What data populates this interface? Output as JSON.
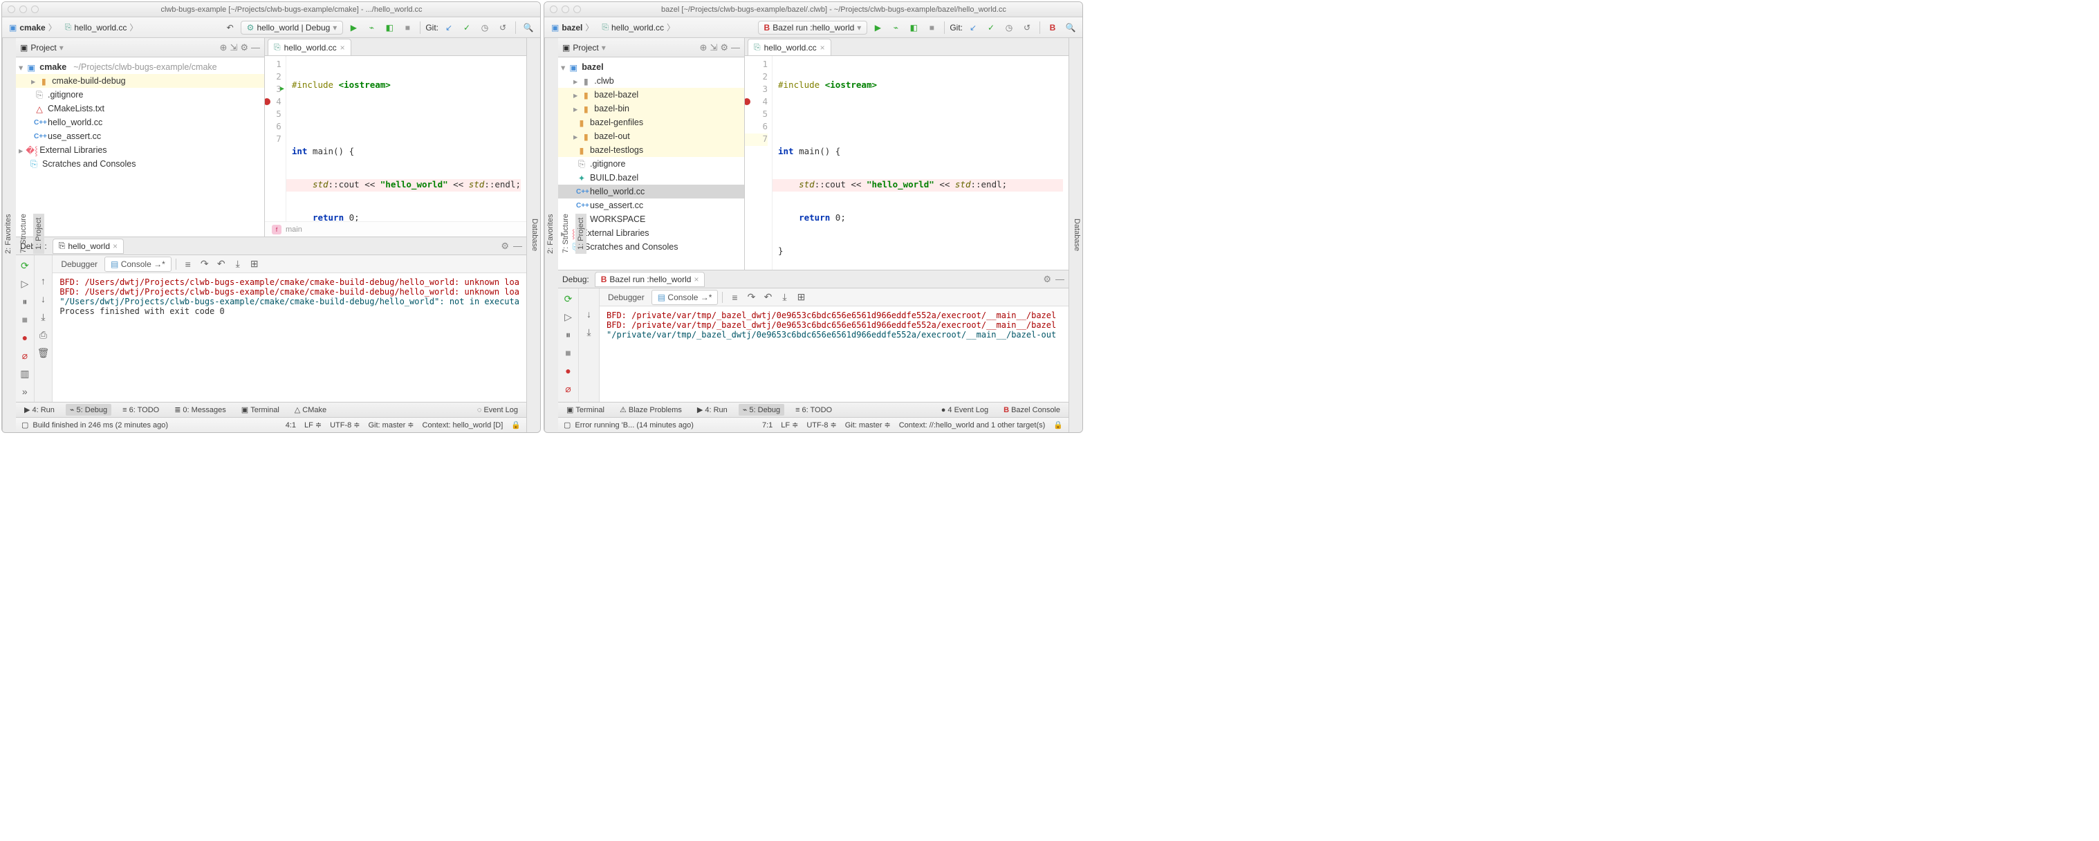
{
  "left": {
    "title": "clwb-bugs-example [~/Projects/clwb-bugs-example/cmake] - .../hello_world.cc",
    "breadcrumb": {
      "root": "cmake",
      "file": "hello_world.cc"
    },
    "run_config": "hello_world | Debug",
    "git_label": "Git:",
    "rail": {
      "project": "1: Project",
      "structure": "7: Structure",
      "favorites": "2: Favorites",
      "database": "Database"
    },
    "project": {
      "header": "Project",
      "root": "cmake",
      "root_path": "~/Projects/clwb-bugs-example/cmake",
      "items": [
        {
          "label": "cmake-build-debug",
          "kind": "folder",
          "indent": 1,
          "highlight": true,
          "expandable": true
        },
        {
          "label": ".gitignore",
          "kind": "file",
          "indent": 1
        },
        {
          "label": "CMakeLists.txt",
          "kind": "cmake",
          "indent": 1
        },
        {
          "label": "hello_world.cc",
          "kind": "cc",
          "indent": 1
        },
        {
          "label": "use_assert.cc",
          "kind": "cc",
          "indent": 1
        }
      ],
      "ext_libs": "External Libraries",
      "scratches": "Scratches and Consoles"
    },
    "editor": {
      "tab": "hello_world.cc",
      "lines": [
        "1",
        "2",
        "3",
        "4",
        "5",
        "6",
        "7"
      ],
      "code": {
        "l1_pre": "#include",
        "l1_inc": "<iostream>",
        "l3_kw1": "int",
        "l3_rest": " main() {",
        "l4_ns1": "std",
        "l4_op1": "::cout << ",
        "l4_str": "\"hello_world\"",
        "l4_op2": " << ",
        "l4_ns2": "std",
        "l4_op3": "::endl;",
        "l5_kw": "return",
        "l5_rest": " 0;",
        "l6": "}"
      },
      "footer_symbol": "main"
    },
    "debug": {
      "label": "Debug:",
      "run_tab": "hello_world",
      "debugger": "Debugger",
      "console": "Console",
      "console_lines": [
        "BFD: /Users/dwtj/Projects/clwb-bugs-example/cmake/cmake-build-debug/hello_world: unknown loa",
        "BFD: /Users/dwtj/Projects/clwb-bugs-example/cmake/cmake-build-debug/hello_world: unknown loa",
        "\"/Users/dwtj/Projects/clwb-bugs-example/cmake/cmake-build-debug/hello_world\": not in executa",
        "",
        "Process finished with exit code 0"
      ]
    },
    "bottom": {
      "run": "4: Run",
      "debug": "5: Debug",
      "todo": "6: TODO",
      "messages": "0: Messages",
      "terminal": "Terminal",
      "cmake": "CMake",
      "eventlog": "Event Log"
    },
    "status": {
      "msg": "Build finished in 246 ms (2 minutes ago)",
      "caret": "4:1",
      "le": "LF",
      "enc": "UTF-8",
      "git": "Git: master",
      "ctx": "Context: hello_world [D]"
    }
  },
  "right": {
    "title": "bazel [~/Projects/clwb-bugs-example/bazel/.clwb] - ~/Projects/clwb-bugs-example/bazel/hello_world.cc",
    "breadcrumb": {
      "root": "bazel",
      "file": "hello_world.cc"
    },
    "run_config": "Bazel run :hello_world",
    "git_label": "Git:",
    "rail": {
      "project": "1: Project",
      "structure": "7: Structure",
      "favorites": "2: Favorites",
      "database": "Database"
    },
    "project": {
      "header": "Project",
      "root": "bazel",
      "root_path": "",
      "items": [
        {
          "label": ".clwb",
          "kind": "folder-dim",
          "indent": 1,
          "expandable": true
        },
        {
          "label": "bazel-bazel",
          "kind": "folder",
          "indent": 1,
          "highlight": true,
          "expandable": true
        },
        {
          "label": "bazel-bin",
          "kind": "folder",
          "indent": 1,
          "highlight": true,
          "expandable": true
        },
        {
          "label": "bazel-genfiles",
          "kind": "folder",
          "indent": 1,
          "highlight": true
        },
        {
          "label": "bazel-out",
          "kind": "folder",
          "indent": 1,
          "highlight": true,
          "expandable": true
        },
        {
          "label": "bazel-testlogs",
          "kind": "folder",
          "indent": 1,
          "highlight": true
        },
        {
          "label": ".gitignore",
          "kind": "file",
          "indent": 1
        },
        {
          "label": "BUILD.bazel",
          "kind": "bazel",
          "indent": 1
        },
        {
          "label": "hello_world.cc",
          "kind": "cc",
          "indent": 1,
          "selected": true
        },
        {
          "label": "use_assert.cc",
          "kind": "cc",
          "indent": 1
        },
        {
          "label": "WORKSPACE",
          "kind": "file",
          "indent": 1
        }
      ],
      "ext_libs": "External Libraries",
      "scratches": "Scratches and Consoles"
    },
    "editor": {
      "tab": "hello_world.cc",
      "lines": [
        "1",
        "2",
        "3",
        "4",
        "5",
        "6",
        "7"
      ],
      "code": {
        "l1_pre": "#include",
        "l1_inc": "<iostream>",
        "l3_kw1": "int",
        "l3_rest": " main() {",
        "l4_ns1": "std",
        "l4_op1": "::cout << ",
        "l4_str": "\"hello_world\"",
        "l4_op2": " << ",
        "l4_ns2": "std",
        "l4_op3": "::endl;",
        "l5_kw": "return",
        "l5_rest": " 0;",
        "l6": "}"
      }
    },
    "debug": {
      "label": "Debug:",
      "run_tab": "Bazel run :hello_world",
      "debugger": "Debugger",
      "console": "Console",
      "console_lines": [
        "BFD: /private/var/tmp/_bazel_dwtj/0e9653c6bdc656e6561d966eddfe552a/execroot/__main__/bazel",
        "BFD: /private/var/tmp/_bazel_dwtj/0e9653c6bdc656e6561d966eddfe552a/execroot/__main__/bazel",
        "\"/private/var/tmp/_bazel_dwtj/0e9653c6bdc656e6561d966eddfe552a/execroot/__main__/bazel-out"
      ]
    },
    "bottom": {
      "terminal": "Terminal",
      "blaze": "Blaze Problems",
      "run": "4: Run",
      "debug": "5: Debug",
      "todo": "6: TODO",
      "eventlog": "4 Event Log",
      "bazelconsole": "Bazel Console"
    },
    "status": {
      "msg": "Error running 'B... (14 minutes ago)",
      "caret": "7:1",
      "le": "LF",
      "enc": "UTF-8",
      "git": "Git: master",
      "ctx": "Context: //:hello_world and 1 other target(s)"
    }
  }
}
